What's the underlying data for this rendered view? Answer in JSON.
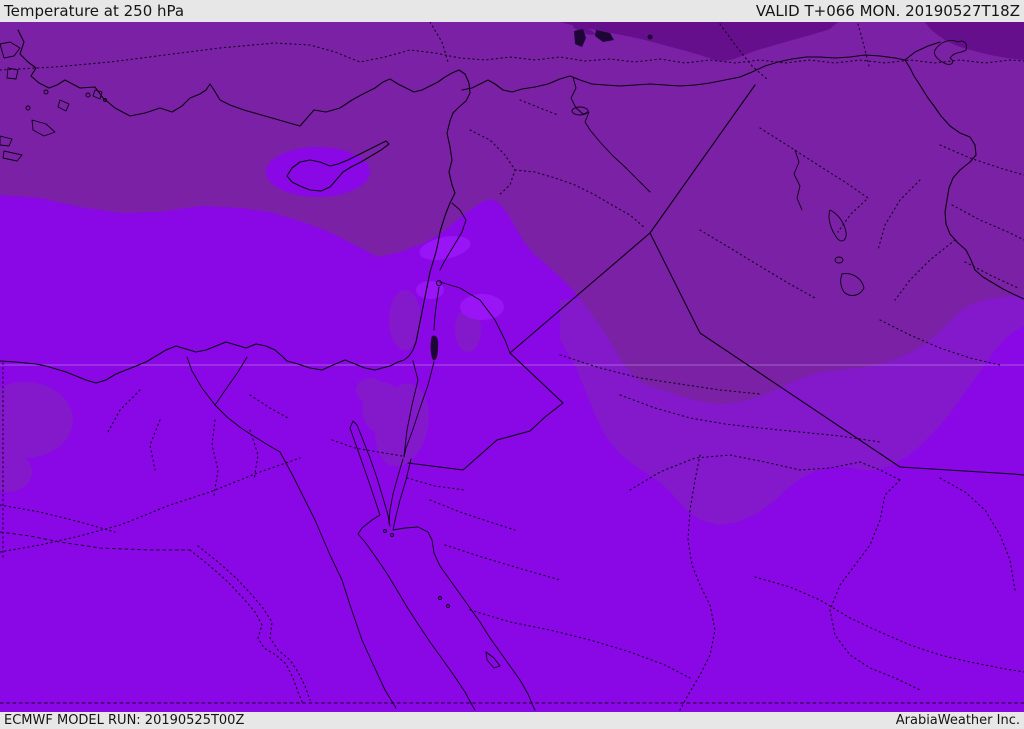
{
  "header": {
    "title": "Temperature at 250 hPa",
    "valid": "VALID T+066 MON. 20190527T18Z"
  },
  "footer": {
    "model_run": "ECMWF MODEL RUN: 20190525T00Z",
    "branding": "ArabiaWeather Inc."
  },
  "map": {
    "kind": "filled temperature contour map",
    "region": "Eastern Mediterranean / Middle East",
    "colors": {
      "bar_bg": "#e7e7e7",
      "bar_text": "#151515",
      "temp_warmest": "#9a15f5",
      "temp_warm": "#8a07e6",
      "temp_mid": "#8319cb",
      "temp_cool": "#7b21a6",
      "temp_coldest": "#660f8c",
      "border_line": "#0a0210",
      "lake_fill": "#1d0536",
      "parallel_line": "#d8d0e8"
    }
  }
}
